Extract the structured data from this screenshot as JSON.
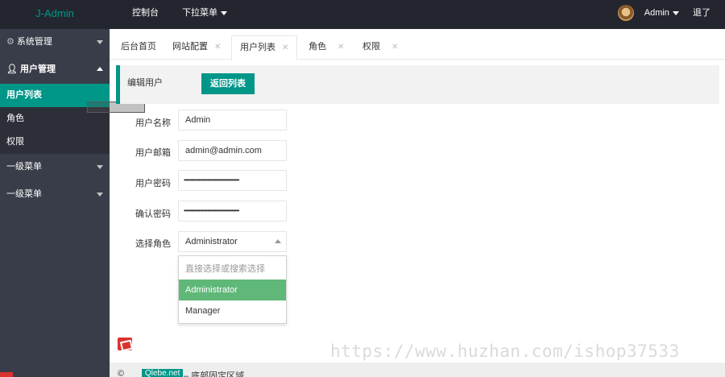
{
  "app": {
    "logo": "J-Admin"
  },
  "topnav": {
    "console": "控制台",
    "dropdown": "下拉菜单"
  },
  "user": {
    "name": "Admin",
    "logout": "退了"
  },
  "sidebar": {
    "system": "系统管理",
    "user_mgmt": "用户管理",
    "sub_items": [
      "用户列表",
      "角色",
      "权限"
    ],
    "level1_a": "一级菜单",
    "level1_b": "一级菜单"
  },
  "tabs": [
    "后台首页",
    "网站配置",
    "用户列表",
    "角色",
    "权限"
  ],
  "page": {
    "title": "编辑用户",
    "back_button": "返回列表"
  },
  "form": {
    "username_label": "用户名称",
    "username_value": "Admin",
    "email_label": "用户邮箱",
    "email_value": "admin@admin.com",
    "password_label": "用户密码",
    "password_value": "••••••••••••••••••••••••••••••••••••••",
    "confirm_label": "确认密码",
    "confirm_value": "••••••••••••••••••••••••••••••••••••••",
    "role_label": "选择角色",
    "role_value": "Administrator"
  },
  "role_options": {
    "placeholder": "直接选择或搜索选择",
    "options": [
      "Administrator",
      "Manager"
    ]
  },
  "footer": {
    "copyright": "©",
    "link": "Qlebe.net",
    "text": "– 底部固定区域"
  },
  "watermark": "https://www.huzhan.com/ishop37533",
  "colors": {
    "topbar": "#23262e",
    "sidebar": "#393d49",
    "accent": "#009688",
    "selected": "#5fb878"
  }
}
